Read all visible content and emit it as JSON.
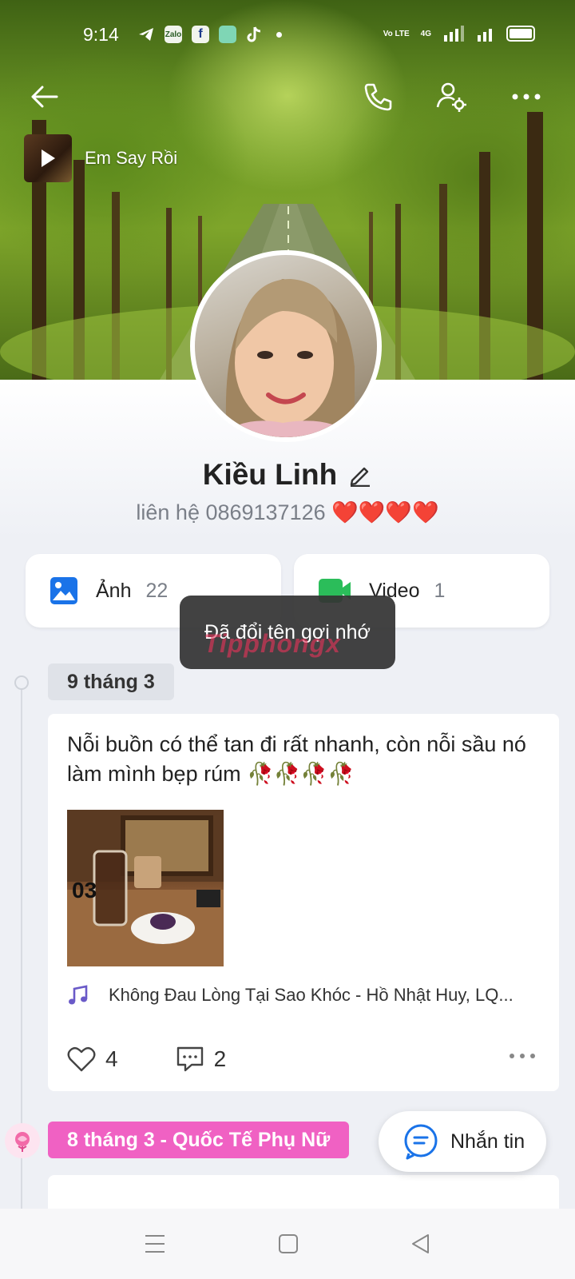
{
  "status_bar": {
    "time": "9:14",
    "app_icons": [
      "telegram-icon",
      "zalo-icon",
      "facebook-icon",
      "app-icon",
      "tiktok-icon"
    ],
    "zalo_label": "Zalo",
    "network_labels": [
      "Vo LTE",
      "4G"
    ]
  },
  "header": {
    "back_icon": "back-arrow-icon",
    "call_icon": "phone-icon",
    "settings_icon": "user-settings-icon",
    "more_icon": "more-icon"
  },
  "profile_music": {
    "title": "Em Say Rồi"
  },
  "profile": {
    "name": "Kiều Linh",
    "bio": "liên hệ 0869137126 ❤️❤️❤️❤️"
  },
  "media": {
    "photos": {
      "label": "Ảnh",
      "count": "22"
    },
    "videos": {
      "label": "Video",
      "count": "1"
    }
  },
  "toast": {
    "message": "Đã đổi tên gợi nhớ"
  },
  "watermark": {
    "text": "Tipphongx"
  },
  "timeline": [
    {
      "date": "9 tháng 3",
      "text": "Nỗi buồn có thể tan đi rất nhanh, còn nỗi sầu nó làm mình bẹp rúm 🥀🥀🥀🥀",
      "song": "Không Đau Lòng Tại Sao Khóc - Hồ Nhật Huy, LQ...",
      "likes": "4",
      "comments": "2"
    },
    {
      "date": "8 tháng 3 - Quốc Tế Phụ Nữ"
    }
  ],
  "chat_button": {
    "label": "Nhắn tin"
  },
  "colors": {
    "accent_blue": "#1a73e8",
    "video_green": "#2bbd5a",
    "women_day_pink": "#f061c3",
    "music_purple": "#6a5ac8"
  }
}
